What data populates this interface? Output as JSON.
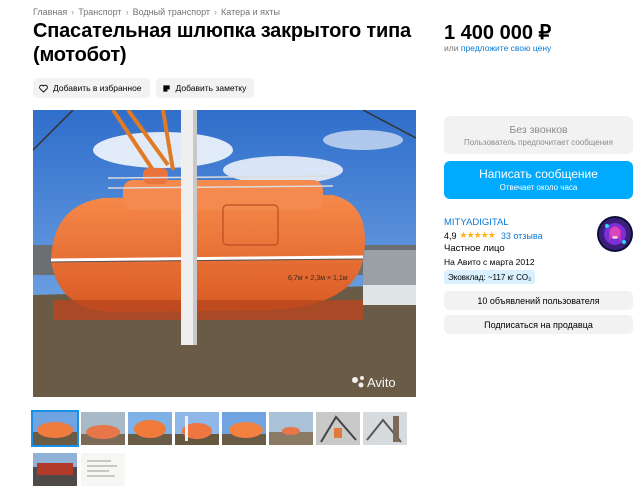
{
  "breadcrumb": [
    "Главная",
    "Транспорт",
    "Водный транспорт",
    "Катера и яхты"
  ],
  "title": "Спасательная шлюпка закрытого типа (мотобот)",
  "actions": {
    "favorite": "Добавить в избранное",
    "note": "Добавить заметку"
  },
  "photo": {
    "watermark": "Avito",
    "hull_text": "6,7м × 2,3м × 1,1м"
  },
  "thumbnails_count": 10,
  "price": {
    "value": "1 400 000 ₽",
    "or": "или",
    "offer_link": "предложите свою цену"
  },
  "no_calls": {
    "title": "Без звонков",
    "subtitle": "Пользователь предпочитает сообщения"
  },
  "message_button": {
    "title": "Написать сообщение",
    "subtitle": "Отвечает около часа"
  },
  "seller": {
    "name": "MITYADIGITAL",
    "rating": "4,9",
    "stars": "★★★★★",
    "reviews": "33 отзыва",
    "type": "Частное лицо",
    "since": "На Авито с марта 2012",
    "eco": "Эковклад: ~117 кг CO₂"
  },
  "user_listings": "10 объявлений пользователя",
  "subscribe": "Подписаться на продавца",
  "colors": {
    "accent_blue": "#00aaff",
    "link_blue": "#0a7ad6",
    "boat_orange": "#f07a3a",
    "star": "#ffb021"
  },
  "icons": [
    "heart-icon",
    "note-icon",
    "avito-logo-icon"
  ]
}
